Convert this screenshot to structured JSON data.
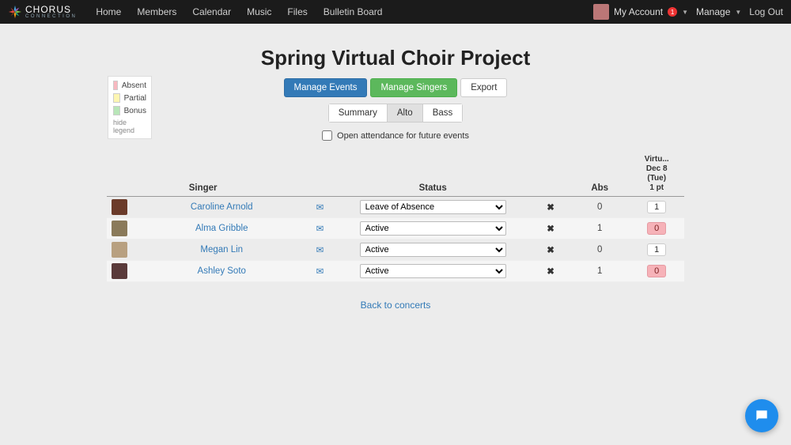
{
  "brand": {
    "top": "CHORUS",
    "bottom": "CONNECTION"
  },
  "nav": {
    "links": [
      "Home",
      "Members",
      "Calendar",
      "Music",
      "Files",
      "Bulletin Board"
    ],
    "account_label": "My Account",
    "account_badge": "1",
    "manage_label": "Manage",
    "logout_label": "Log Out"
  },
  "legend": {
    "absent": "Absent",
    "partial": "Partial",
    "bonus": "Bonus",
    "hide": "hide legend"
  },
  "title": "Spring Virtual Choir Project",
  "buttons": {
    "manage_events": "Manage Events",
    "manage_singers": "Manage Singers",
    "export": "Export"
  },
  "tabs": {
    "summary": "Summary",
    "alto": "Alto",
    "bass": "Bass",
    "active": "alto"
  },
  "open_attendance_label": "Open attendance for future events",
  "open_attendance_checked": false,
  "table": {
    "headers": {
      "singer": "Singer",
      "status": "Status",
      "abs": "Abs"
    },
    "event": {
      "name": "Virtu...",
      "date": "Dec 8",
      "day": "(Tue)",
      "pts": "1 pt"
    },
    "status_options": [
      "Active",
      "Leave of Absence"
    ],
    "rows": [
      {
        "name": "Caroline Arnold",
        "status": "Leave of Absence",
        "abs": "0",
        "score": "1",
        "absent": false
      },
      {
        "name": "Alma Gribble",
        "status": "Active",
        "abs": "1",
        "score": "0",
        "absent": true
      },
      {
        "name": "Megan Lin",
        "status": "Active",
        "abs": "0",
        "score": "1",
        "absent": false
      },
      {
        "name": "Ashley Soto",
        "status": "Active",
        "abs": "1",
        "score": "0",
        "absent": true
      }
    ]
  },
  "back_link": "Back to concerts"
}
